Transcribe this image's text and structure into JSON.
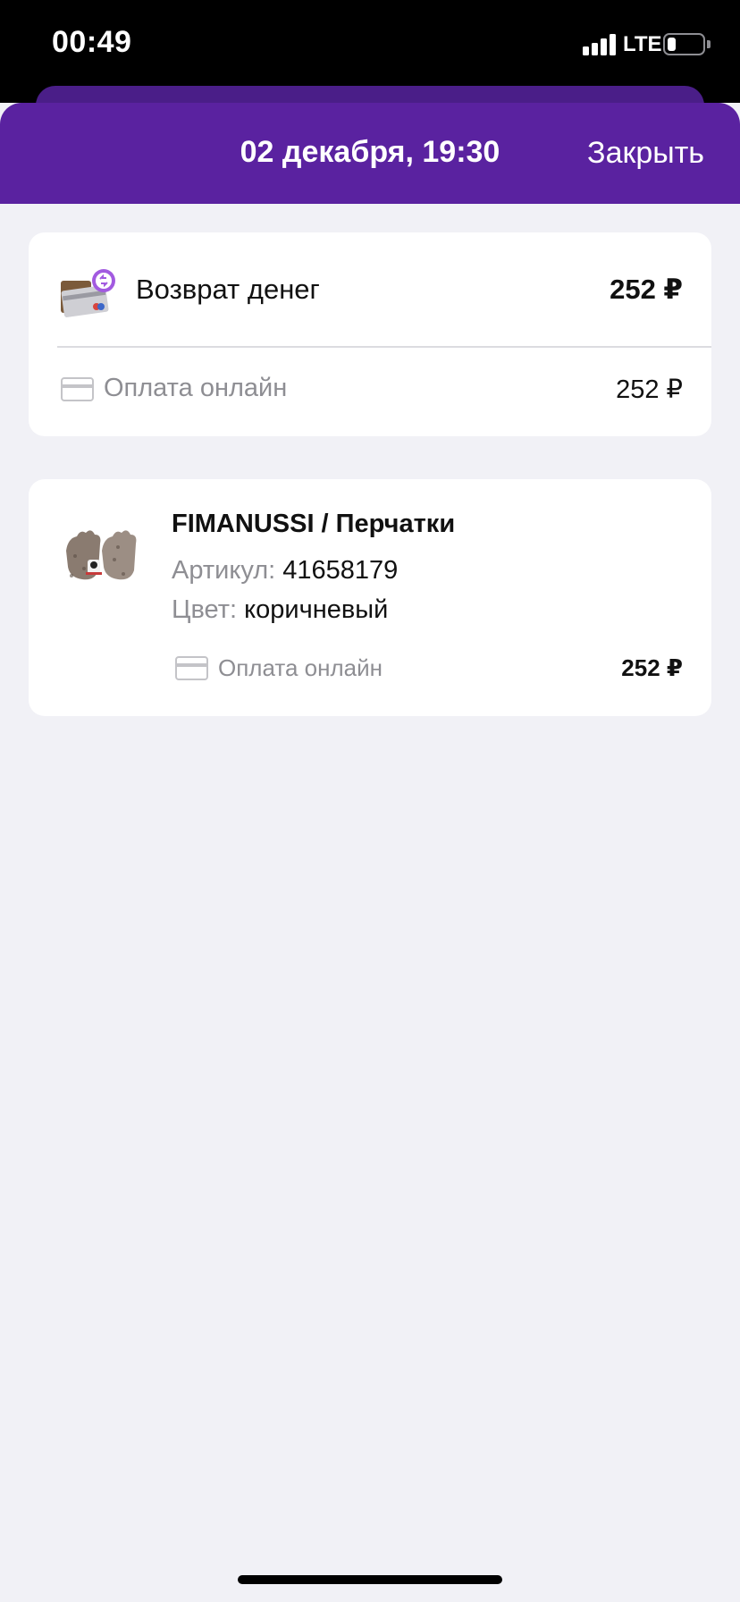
{
  "status_bar": {
    "time": "00:49",
    "network": "LTE"
  },
  "header": {
    "title": "02 декабря, 19:30",
    "close_label": "Закрыть",
    "background_color": "#5a22a0"
  },
  "refund": {
    "label": "Возврат денег",
    "amount": "252 ₽",
    "icon": "refund-card-icon",
    "payment": {
      "label": "Оплата онлайн",
      "amount": "252 ₽",
      "icon": "credit-card-icon"
    }
  },
  "product": {
    "title": "FIMANUSSI / Перчатки",
    "sku_label": "Артикул:",
    "sku_value": "41658179",
    "color_label": "Цвет:",
    "color_value": "коричневый",
    "image": "gloves-image",
    "payment": {
      "label": "Оплата онлайн",
      "amount": "252 ₽",
      "icon": "credit-card-icon"
    }
  }
}
